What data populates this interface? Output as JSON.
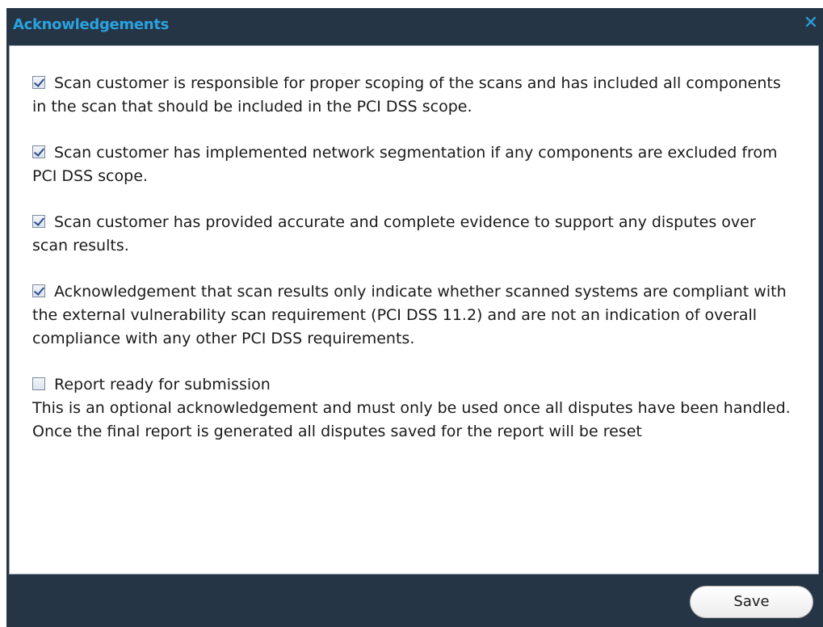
{
  "dialog": {
    "title": "Acknowledgements",
    "close_glyph": "✕",
    "close_icon": "close-icon",
    "save_label": "Save"
  },
  "acknowledgements": [
    {
      "checked": true,
      "text": "Scan customer is responsible for proper scoping of the scans and has included all components in the scan that should be included in the PCI DSS scope."
    },
    {
      "checked": true,
      "text": "Scan customer has implemented network segmentation if any components are excluded from PCI DSS scope."
    },
    {
      "checked": true,
      "text": "Scan customer has provided accurate and complete evidence to support any disputes over scan results."
    },
    {
      "checked": true,
      "text": "Acknowledgement that scan results only indicate whether scanned systems are compliant with the external vulnerability scan requirement (PCI DSS 11.2) and are not an indication of overall compliance with any other PCI DSS requirements."
    }
  ],
  "report_ready": {
    "checked": false,
    "label": "Report ready for submission",
    "note": "This is an optional acknowledgement and must only be used once all disputes have been handled. Once the final report is generated all disputes saved for the report will be reset"
  },
  "colors": {
    "dialog_background": "#263545",
    "title_accent": "#29a3e0"
  }
}
